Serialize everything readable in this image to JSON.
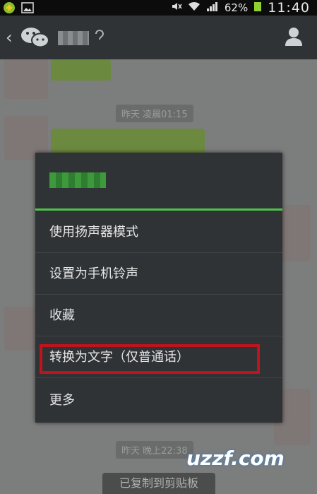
{
  "status_bar": {
    "battery": "62%",
    "time": "11:40"
  },
  "title_bar": {
    "back_glyph": "‹"
  },
  "chat": {
    "timestamps": [
      "昨天 凌晨01:15",
      "昨天 晚上22:38"
    ],
    "toast": "已复制到剪贴板"
  },
  "menu": {
    "items": [
      "使用扬声器模式",
      "设置为手机铃声",
      "收藏",
      "转换为文字（仅普通话）",
      "更多"
    ]
  },
  "watermark": {
    "text": "uzzf.com"
  },
  "colors": {
    "accent": "#4ec24a",
    "highlight": "#c0141c",
    "bubble": "#6c8a3f"
  }
}
